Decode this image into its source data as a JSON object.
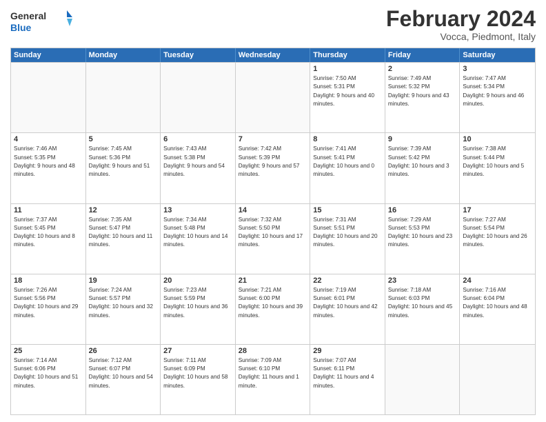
{
  "logo": {
    "general": "General",
    "blue": "Blue"
  },
  "header": {
    "title": "February 2024",
    "subtitle": "Vocca, Piedmont, Italy"
  },
  "days": [
    "Sunday",
    "Monday",
    "Tuesday",
    "Wednesday",
    "Thursday",
    "Friday",
    "Saturday"
  ],
  "weeks": [
    [
      {
        "day": "",
        "empty": true
      },
      {
        "day": "",
        "empty": true
      },
      {
        "day": "",
        "empty": true
      },
      {
        "day": "",
        "empty": true
      },
      {
        "day": "1",
        "sunrise": "7:50 AM",
        "sunset": "5:31 PM",
        "daylight": "9 hours and 40 minutes."
      },
      {
        "day": "2",
        "sunrise": "7:49 AM",
        "sunset": "5:32 PM",
        "daylight": "9 hours and 43 minutes."
      },
      {
        "day": "3",
        "sunrise": "7:47 AM",
        "sunset": "5:34 PM",
        "daylight": "9 hours and 46 minutes."
      }
    ],
    [
      {
        "day": "4",
        "sunrise": "7:46 AM",
        "sunset": "5:35 PM",
        "daylight": "9 hours and 48 minutes."
      },
      {
        "day": "5",
        "sunrise": "7:45 AM",
        "sunset": "5:36 PM",
        "daylight": "9 hours and 51 minutes."
      },
      {
        "day": "6",
        "sunrise": "7:43 AM",
        "sunset": "5:38 PM",
        "daylight": "9 hours and 54 minutes."
      },
      {
        "day": "7",
        "sunrise": "7:42 AM",
        "sunset": "5:39 PM",
        "daylight": "9 hours and 57 minutes."
      },
      {
        "day": "8",
        "sunrise": "7:41 AM",
        "sunset": "5:41 PM",
        "daylight": "10 hours and 0 minutes."
      },
      {
        "day": "9",
        "sunrise": "7:39 AM",
        "sunset": "5:42 PM",
        "daylight": "10 hours and 3 minutes."
      },
      {
        "day": "10",
        "sunrise": "7:38 AM",
        "sunset": "5:44 PM",
        "daylight": "10 hours and 5 minutes."
      }
    ],
    [
      {
        "day": "11",
        "sunrise": "7:37 AM",
        "sunset": "5:45 PM",
        "daylight": "10 hours and 8 minutes."
      },
      {
        "day": "12",
        "sunrise": "7:35 AM",
        "sunset": "5:47 PM",
        "daylight": "10 hours and 11 minutes."
      },
      {
        "day": "13",
        "sunrise": "7:34 AM",
        "sunset": "5:48 PM",
        "daylight": "10 hours and 14 minutes."
      },
      {
        "day": "14",
        "sunrise": "7:32 AM",
        "sunset": "5:50 PM",
        "daylight": "10 hours and 17 minutes."
      },
      {
        "day": "15",
        "sunrise": "7:31 AM",
        "sunset": "5:51 PM",
        "daylight": "10 hours and 20 minutes."
      },
      {
        "day": "16",
        "sunrise": "7:29 AM",
        "sunset": "5:53 PM",
        "daylight": "10 hours and 23 minutes."
      },
      {
        "day": "17",
        "sunrise": "7:27 AM",
        "sunset": "5:54 PM",
        "daylight": "10 hours and 26 minutes."
      }
    ],
    [
      {
        "day": "18",
        "sunrise": "7:26 AM",
        "sunset": "5:56 PM",
        "daylight": "10 hours and 29 minutes."
      },
      {
        "day": "19",
        "sunrise": "7:24 AM",
        "sunset": "5:57 PM",
        "daylight": "10 hours and 32 minutes."
      },
      {
        "day": "20",
        "sunrise": "7:23 AM",
        "sunset": "5:59 PM",
        "daylight": "10 hours and 36 minutes."
      },
      {
        "day": "21",
        "sunrise": "7:21 AM",
        "sunset": "6:00 PM",
        "daylight": "10 hours and 39 minutes."
      },
      {
        "day": "22",
        "sunrise": "7:19 AM",
        "sunset": "6:01 PM",
        "daylight": "10 hours and 42 minutes."
      },
      {
        "day": "23",
        "sunrise": "7:18 AM",
        "sunset": "6:03 PM",
        "daylight": "10 hours and 45 minutes."
      },
      {
        "day": "24",
        "sunrise": "7:16 AM",
        "sunset": "6:04 PM",
        "daylight": "10 hours and 48 minutes."
      }
    ],
    [
      {
        "day": "25",
        "sunrise": "7:14 AM",
        "sunset": "6:06 PM",
        "daylight": "10 hours and 51 minutes."
      },
      {
        "day": "26",
        "sunrise": "7:12 AM",
        "sunset": "6:07 PM",
        "daylight": "10 hours and 54 minutes."
      },
      {
        "day": "27",
        "sunrise": "7:11 AM",
        "sunset": "6:09 PM",
        "daylight": "10 hours and 58 minutes."
      },
      {
        "day": "28",
        "sunrise": "7:09 AM",
        "sunset": "6:10 PM",
        "daylight": "11 hours and 1 minute."
      },
      {
        "day": "29",
        "sunrise": "7:07 AM",
        "sunset": "6:11 PM",
        "daylight": "11 hours and 4 minutes."
      },
      {
        "day": "",
        "empty": true
      },
      {
        "day": "",
        "empty": true
      }
    ]
  ]
}
